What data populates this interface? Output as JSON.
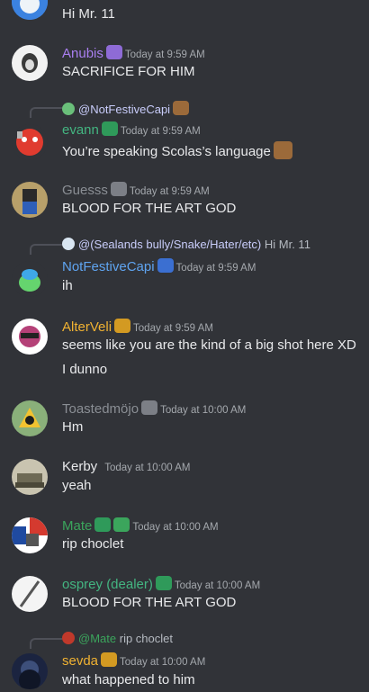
{
  "colors": {
    "background": "#313338",
    "text": "#e8e9eb",
    "timestamp": "#a4a8ad",
    "mention": "#c9cdfb"
  },
  "messages": [
    {
      "id": "m0",
      "text": "Hi Mr. 11"
    },
    {
      "id": "m1",
      "username": "Anubis",
      "name_color": "#a97ff0",
      "badge": "purple-mug-icon",
      "timestamp": "Today at 9:59 AM",
      "text": "SACRIFICE FOR HIM"
    },
    {
      "id": "m2",
      "reply": {
        "user": "@NotFestiveCapi",
        "text": ""
      },
      "username": "evann",
      "name_color": "#43b581",
      "badge": "green-creature-icon",
      "timestamp": "Today at 9:59 AM",
      "text": "You’re speaking Scolas’s language"
    },
    {
      "id": "m3",
      "username": "Guesss",
      "name_color": "#8a8e94",
      "badge": "helmet-icon",
      "timestamp": "Today at 9:59 AM",
      "text": "BLOOD FOR THE ART GOD"
    },
    {
      "id": "m4",
      "reply": {
        "user": "@(Sealands bully/Snake/Hater/etc)",
        "text": "Hi Mr. 11"
      },
      "username": "NotFestiveCapi",
      "name_color": "#5fa4f0",
      "badge": "blue-globe-icon",
      "timestamp": "Today at 9:59 AM",
      "text": "ih"
    },
    {
      "id": "m5",
      "username": "AlterVeli",
      "name_color": "#f0b232",
      "badge": "gold-crest-icon",
      "timestamp": "Today at 9:59 AM",
      "text": "seems like you are the kind of a big shot here XD",
      "extra": "I dunno"
    },
    {
      "id": "m6",
      "username": "Toastedmöjo",
      "name_color": "#8a8e94",
      "badge": "helmet-icon",
      "timestamp": "Today at 10:00 AM",
      "text": "Hm"
    },
    {
      "id": "m7",
      "username": "Kerby",
      "name_color": "#e8e9eb",
      "timestamp": "Today at 10:00 AM",
      "text": "yeah"
    },
    {
      "id": "m8",
      "username": "Mate",
      "name_color": "#3ba55c",
      "badge": "green-mug-icon",
      "timestamp": "Today at 10:00 AM",
      "text": "rip choclet"
    },
    {
      "id": "m9",
      "username": "osprey (dealer)",
      "name_color": "#43b581",
      "badge": "green-creature-icon",
      "timestamp": "Today at 10:00 AM",
      "text": "BLOOD FOR THE ART GOD"
    },
    {
      "id": "m10",
      "reply": {
        "user": "@Mate",
        "text": "rip choclet"
      },
      "username": "sevda",
      "name_color": "#f0b232",
      "badge": "gold-crest-icon",
      "timestamp": "Today at 10:00 AM",
      "text": "what happened to him"
    }
  ]
}
